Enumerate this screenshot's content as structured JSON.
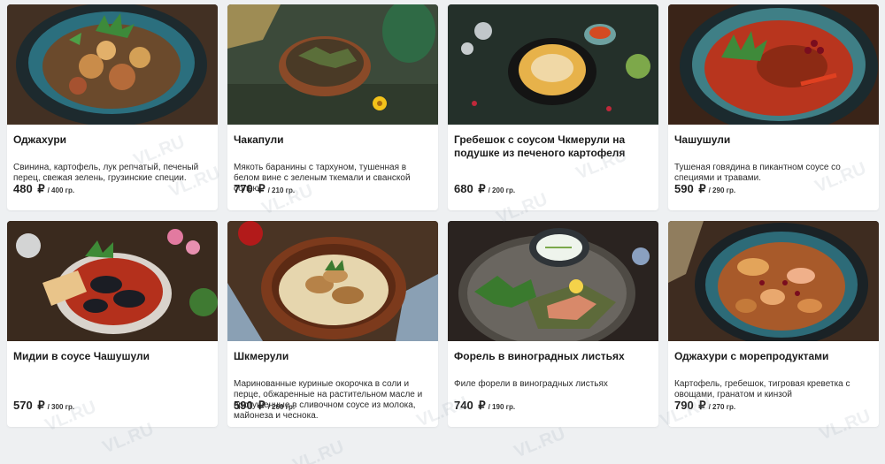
{
  "watermark": "VL.RU",
  "dishes": [
    {
      "title": "Оджахури",
      "desc": "Свинина, картофель, лук репчатый, печеный перец, свежая зелень, грузинские специи.",
      "price": "480",
      "currency": "₽",
      "weight": "/ 400 гр."
    },
    {
      "title": "Чакапули",
      "desc": "Мякоть баранины с тархуном, тушенная в белом вине с зеленым ткемали и сванской солью.",
      "price": "770",
      "currency": "₽",
      "weight": "/ 210 гр."
    },
    {
      "title": "Гребешок с соусом Чкмерули на подушке из печеного картофеля",
      "desc": "",
      "price": "680",
      "currency": "₽",
      "weight": "/ 200 гр."
    },
    {
      "title": "Чашушули",
      "desc": "Тушеная говядина в пикантном соусе со специями и травами.",
      "price": "590",
      "currency": "₽",
      "weight": "/ 290 гр."
    },
    {
      "title": "Мидии в соусе Чашушули",
      "desc": "",
      "price": "570",
      "currency": "₽",
      "weight": "/ 300 гр."
    },
    {
      "title": "Шкмерули",
      "desc": "Маринованные куриные окорочка в соли и перце, обжаренные на растительном масле и протушенные в сливочном соусе из молока, майонеза и чеснока.",
      "price": "590",
      "currency": "₽",
      "weight": "/ 260 гр."
    },
    {
      "title": "Форель в виноградных листьях",
      "desc": "Филе форели в виноградных листьях",
      "price": "740",
      "currency": "₽",
      "weight": "/ 190 гр."
    },
    {
      "title": "Оджахури с морепродуктами",
      "desc": "Картофель, гребешок, тигровая креветка с овощами, гранатом и кинзой",
      "price": "790",
      "currency": "₽",
      "weight": "/ 270 гр."
    }
  ]
}
